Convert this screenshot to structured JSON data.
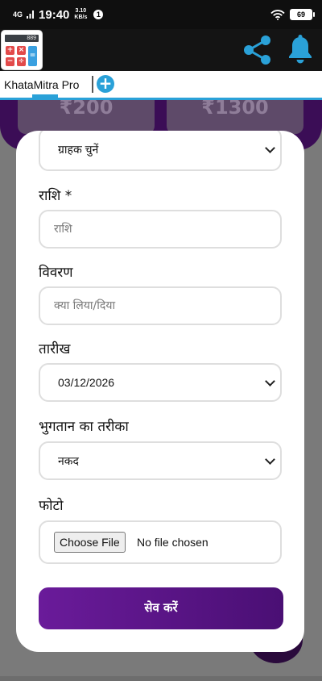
{
  "status_bar": {
    "network": "4G",
    "time": "19:40",
    "speed_value": "3.10",
    "speed_unit": "KB/s",
    "notification_count": "1",
    "battery": "69"
  },
  "app_bar": {
    "logo_display": "889",
    "logo_keys": [
      "+",
      "×",
      "−",
      "÷",
      "="
    ]
  },
  "tabs": {
    "active_label": "KhataMitra Pro",
    "add_label": "+"
  },
  "background": {
    "card_left_amount": "₹200",
    "card_right_amount": "₹1300"
  },
  "form": {
    "customer_select": "ग्राहक चुनें",
    "amount_label": "राशि *",
    "amount_placeholder": "राशि",
    "description_label": "विवरण",
    "description_placeholder": "क्या लिया/दिया",
    "date_label": "तारीख",
    "date_value": "03/12/2026",
    "payment_label": "भुगतान का तरीका",
    "payment_value": "नकद",
    "photo_label": "फोटो",
    "file_button": "Choose File",
    "file_status": "No file chosen",
    "save_button": "सेव करें"
  },
  "colors": {
    "accent": "#2aa1d8",
    "primary": "#6a1b9a",
    "header_bg": "#141414"
  },
  "icons": [
    "share-icon",
    "bell-icon",
    "wifi-icon",
    "signal-icon",
    "battery-icon",
    "chevron-down-icon",
    "calculator-icon"
  ]
}
